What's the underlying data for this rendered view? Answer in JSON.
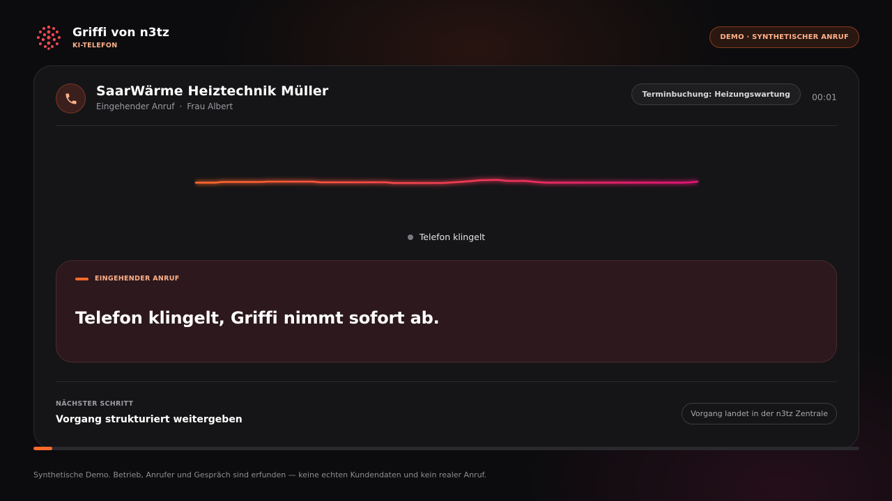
{
  "colors": {
    "accent_orange": "#ff6a2b",
    "accent_pink": "#e8137a",
    "accent_text": "#ffb08a",
    "panel_bg": "#2c181d"
  },
  "header": {
    "logo_icon": "griffi-dots-logo-icon",
    "title": "Griffi von n3tz",
    "subtitle": "KI-TELEFON",
    "demo_badge": "DEMO · SYNTHETISCHER ANRUF"
  },
  "call": {
    "phone_icon": "phone-icon",
    "company": "SaarWärme Heiztechnik Müller",
    "direction": "Eingehender Anruf",
    "separator": "·",
    "caller": "Frau Albert",
    "topic": "Terminbuchung: Heizungswartung",
    "timer": "00:01"
  },
  "status": {
    "label": "Telefon klingelt"
  },
  "event": {
    "label": "EINGEHENDER ANRUF",
    "text": "Telefon klingelt, Griffi nimmt sofort ab."
  },
  "next_step": {
    "label": "NÄCHSTER SCHRITT",
    "text": "Vorgang strukturiert weitergeben",
    "destination": "Vorgang landet in der n3tz Zentrale"
  },
  "progress": {
    "fraction": 0.023
  },
  "footer": {
    "disclaimer": "Synthetische Demo. Betrieb, Anrufer und Gespräch sind erfunden — keine echten Kundendaten und kein realer Anruf."
  }
}
